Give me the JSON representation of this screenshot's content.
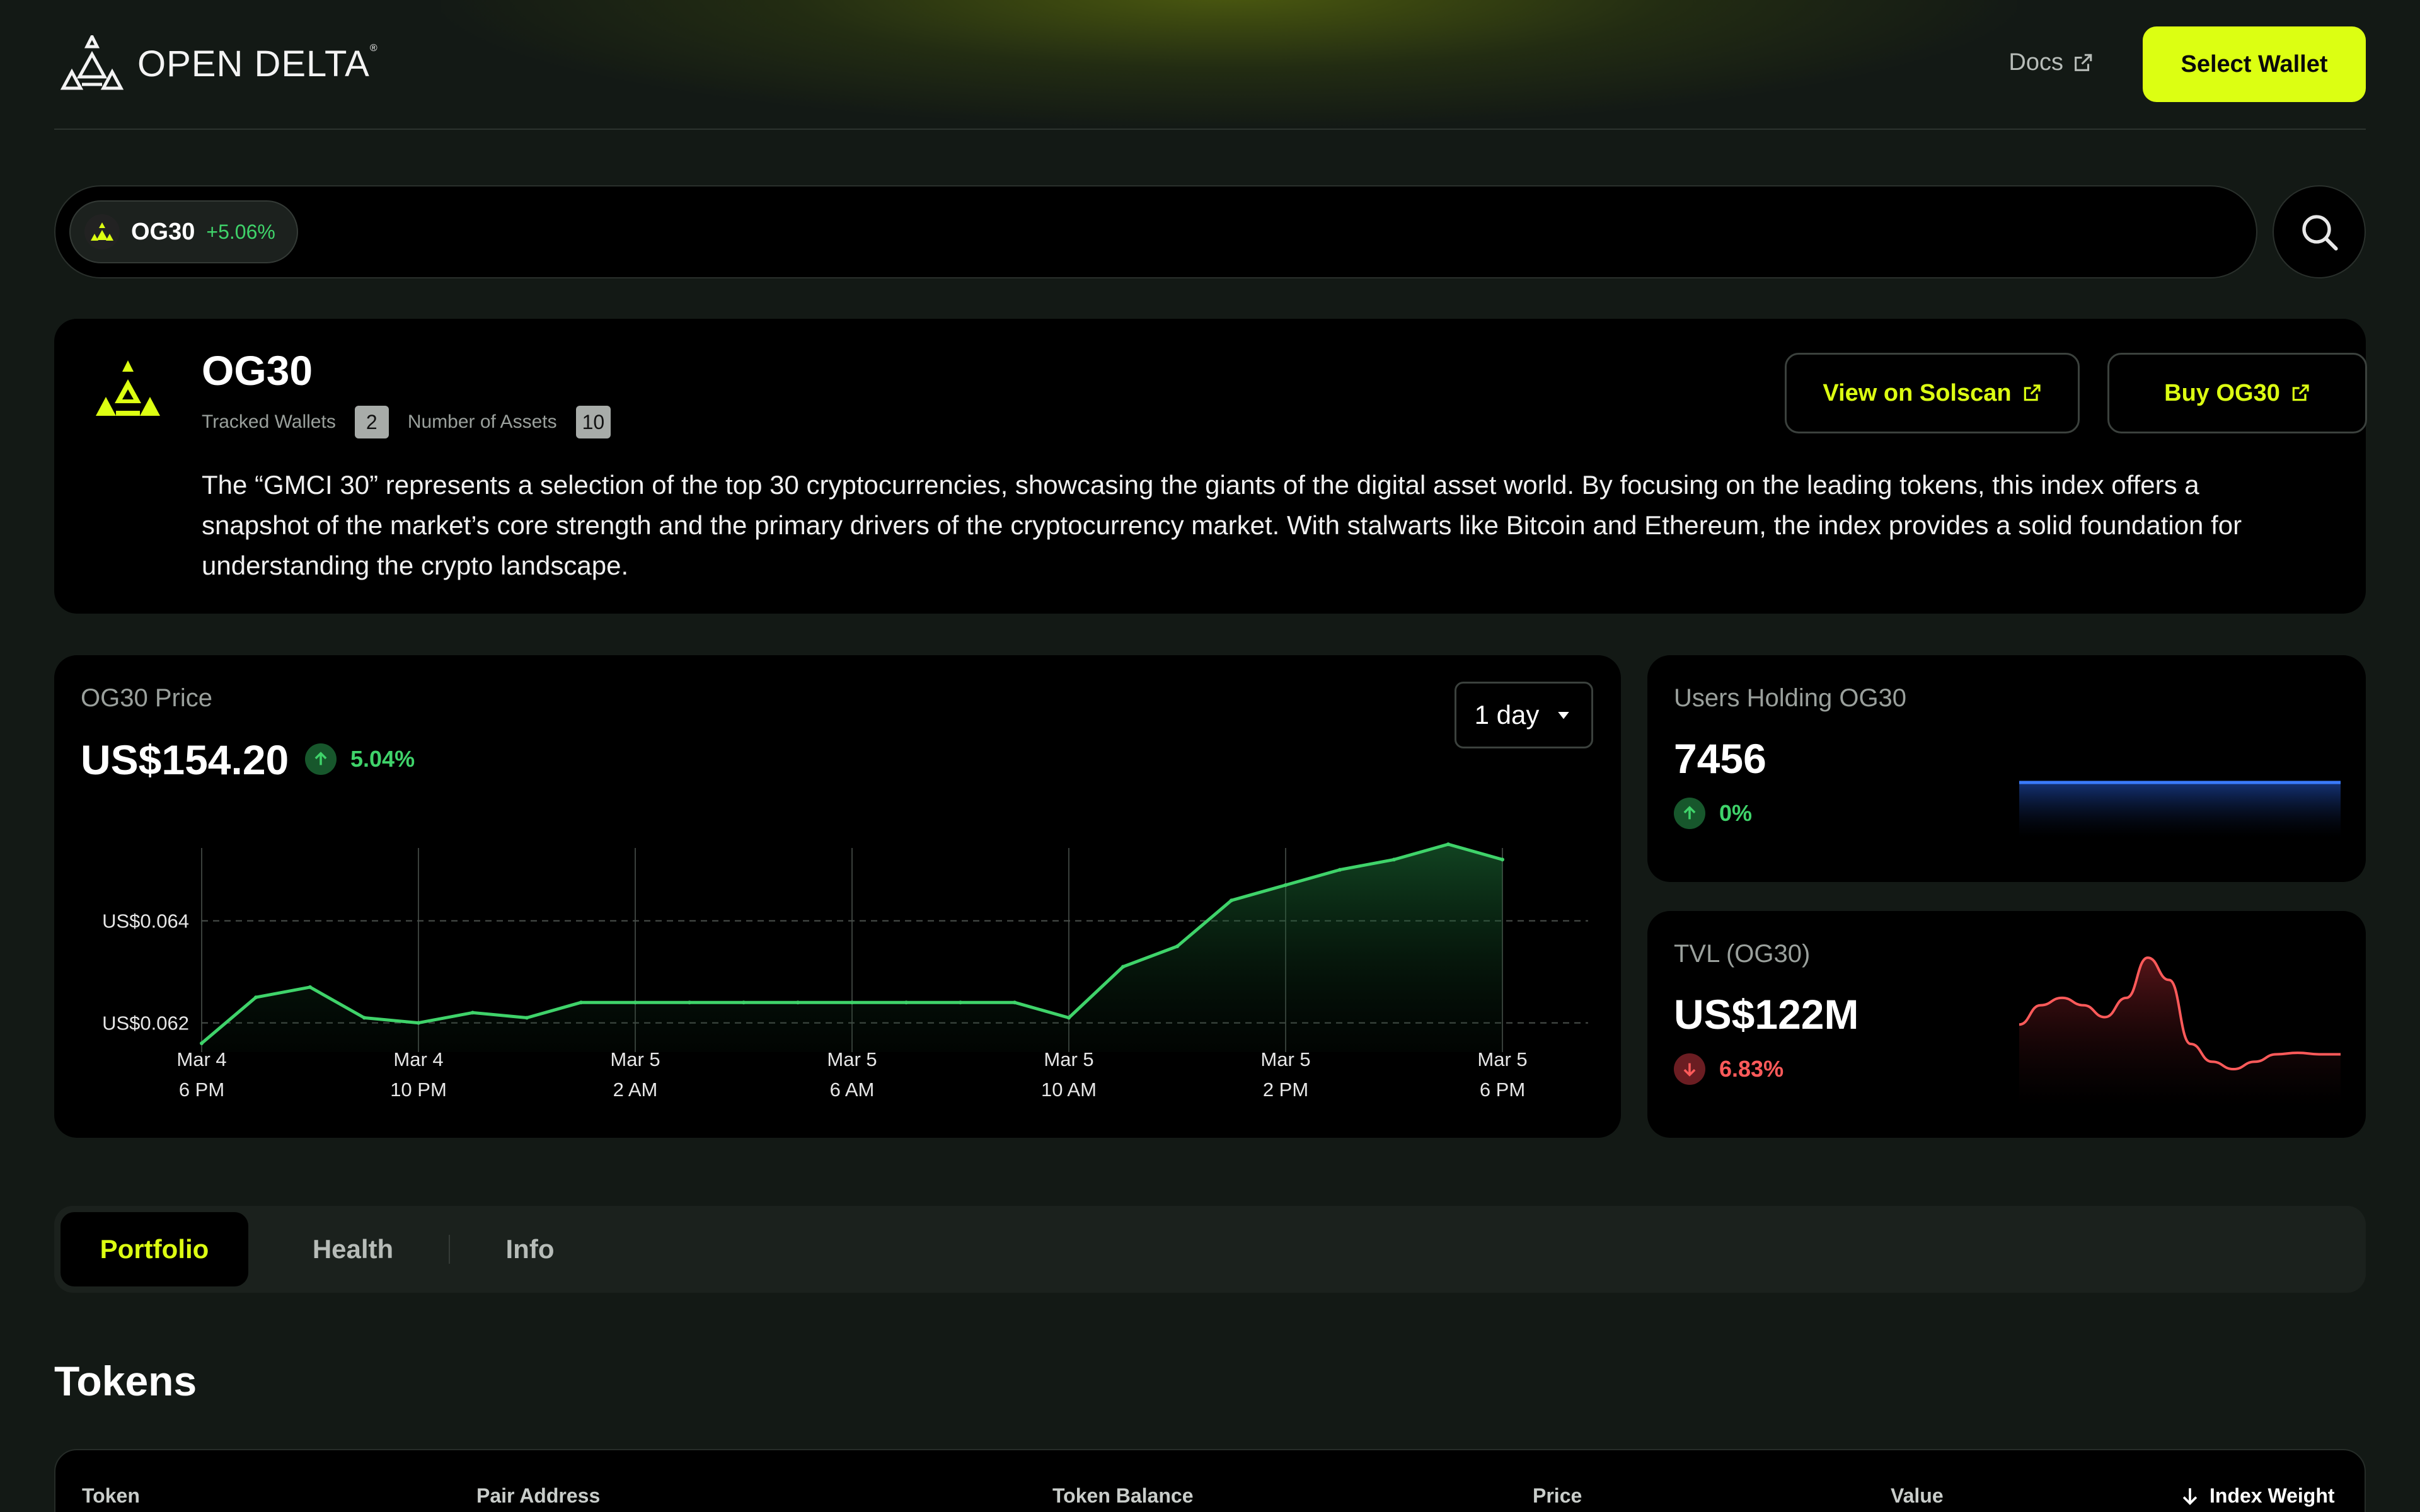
{
  "brand": {
    "name": "OPEN DELTA",
    "mark": "®"
  },
  "header": {
    "docs_label": "Docs",
    "select_wallet_label": "Select Wallet"
  },
  "search": {
    "chip_name": "OG30",
    "chip_change": "+5.06%"
  },
  "index": {
    "name": "OG30",
    "tracked_wallets_label": "Tracked Wallets",
    "tracked_wallets": "2",
    "assets_label": "Number of Assets",
    "assets": "10",
    "description": "The “GMCI 30” represents a selection of the top 30 cryptocurrencies, showcasing the giants of the digital asset world. By focusing on the leading tokens, this index offers a snapshot of the market’s core strength and the primary drivers of the cryptocurrency market. With stalwarts like Bitcoin and Ethereum, the index provides a solid foundation for understanding the crypto landscape.",
    "view_solscan_label": "View on Solscan",
    "buy_label": "Buy OG30"
  },
  "price_card": {
    "label": "OG30 Price",
    "value": "US$154.20",
    "change": "5.04%",
    "timeframe": "1 day"
  },
  "users_card": {
    "label": "Users Holding OG30",
    "value": "7456",
    "change": "0%"
  },
  "tvl_card": {
    "label": "TVL (OG30)",
    "value": "US$122M",
    "change": "6.83%"
  },
  "tabs": {
    "portfolio": "Portfolio",
    "health": "Health",
    "info": "Info"
  },
  "tokens": {
    "title": "Tokens",
    "columns": {
      "token": "Token",
      "pair_address": "Pair Address",
      "token_balance": "Token Balance",
      "price": "Price",
      "value": "Value",
      "index_weight": "Index Weight"
    }
  },
  "colors": {
    "accent": "#dcff12",
    "positive": "#3fd36a",
    "negative": "#ff5a5a",
    "card": "#000000",
    "background": "#131915"
  },
  "chart_data": [
    {
      "type": "area",
      "x_ticks": [
        {
          "date": "Mar 4",
          "time": "6 PM"
        },
        {
          "date": "Mar 4",
          "time": "10 PM"
        },
        {
          "date": "Mar 5",
          "time": "2 AM"
        },
        {
          "date": "Mar 5",
          "time": "6 AM"
        },
        {
          "date": "Mar 5",
          "time": "10 AM"
        },
        {
          "date": "Mar 5",
          "time": "2 PM"
        },
        {
          "date": "Mar 5",
          "time": "6 PM"
        }
      ],
      "x_hours": [
        0,
        1,
        2,
        3,
        4,
        5,
        6,
        7,
        8,
        9,
        10,
        11,
        12,
        13,
        14,
        15,
        16,
        17,
        18,
        19,
        20,
        21,
        22,
        23,
        24
      ],
      "y_values": [
        0.0616,
        0.0625,
        0.0627,
        0.0621,
        0.062,
        0.0622,
        0.0621,
        0.0624,
        0.0624,
        0.0624,
        0.0624,
        0.0624,
        0.0624,
        0.0624,
        0.0624,
        0.0624,
        0.0621,
        0.0631,
        0.0635,
        0.0644,
        0.0647,
        0.065,
        0.0652,
        0.0655,
        0.0652
      ],
      "y_ticks": [
        "US$0.062",
        "US$0.064"
      ],
      "y_tick_values": [
        0.062,
        0.064
      ],
      "ylim": [
        0.0616,
        0.0656
      ],
      "xlim": [
        0,
        25
      ],
      "grid": "vertical solid, horizontal dashed",
      "color": "#3fd36a"
    },
    {
      "type": "area",
      "name_ref": "users",
      "values": [
        7456,
        7456,
        7456,
        7456,
        7456,
        7456,
        7456,
        7456,
        7456,
        7456,
        7456,
        7456,
        7456,
        7456,
        7456,
        7456,
        7456,
        7456,
        7456,
        7456,
        7456,
        7456,
        7456,
        7456,
        7456
      ],
      "color": "#3a7bff"
    },
    {
      "type": "area",
      "name_ref": "tvl",
      "values": [
        0.55,
        0.68,
        0.73,
        0.68,
        0.6,
        0.73,
        1.0,
        0.85,
        0.42,
        0.3,
        0.25,
        0.3,
        0.35,
        0.36,
        0.35,
        0.35
      ],
      "color": "#ff5a5a"
    }
  ]
}
